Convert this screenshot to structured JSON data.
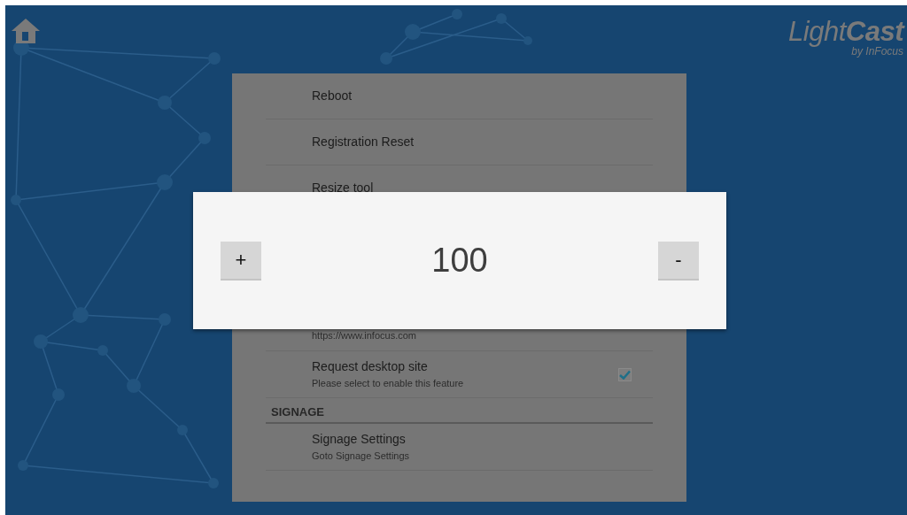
{
  "logo": {
    "title": "Light**Cast**",
    "tagline": "by InFocus"
  },
  "settings": {
    "items": [
      {
        "kind": "action",
        "title": "Reboot"
      },
      {
        "kind": "action",
        "title": "Registration Reset"
      },
      {
        "kind": "action",
        "title": "Resize tool"
      },
      {
        "kind": "action",
        "subtitle": "https://www.infocus.com"
      },
      {
        "kind": "checkbox",
        "title": "Request desktop site",
        "subtitle": "Please select to enable this feature",
        "checked": true
      },
      {
        "kind": "header",
        "title": "SIGNAGE"
      },
      {
        "kind": "action",
        "title": "Signage Settings",
        "subtitle": "Goto Signage Settings"
      }
    ]
  },
  "dialog": {
    "increase": "+",
    "value": "100",
    "decrease": "-"
  }
}
